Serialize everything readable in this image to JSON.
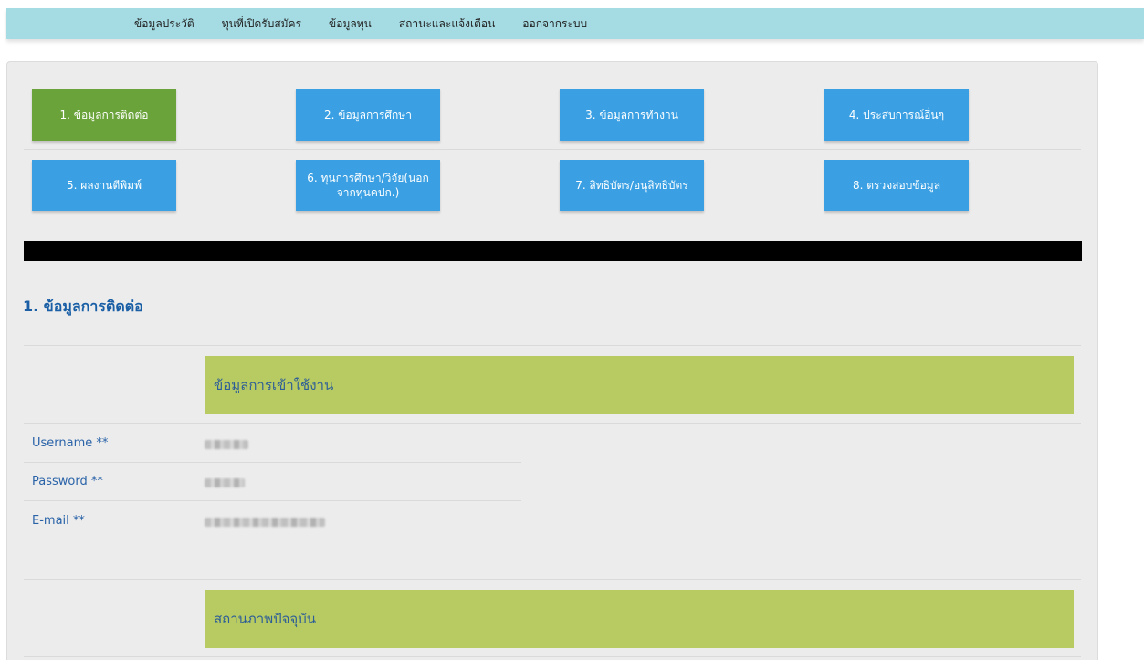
{
  "nav": {
    "items": [
      {
        "label": "ข้อมูลประวัติ"
      },
      {
        "label": "ทุนที่เปิดรับสมัคร"
      },
      {
        "label": "ข้อมูลทุน"
      },
      {
        "label": "สถานะและแจ้งเตือน"
      },
      {
        "label": "ออกจากระบบ"
      }
    ]
  },
  "steps": [
    {
      "label": "1. ข้อมูลการติดต่อ",
      "active": true
    },
    {
      "label": "2. ข้อมูลการศึกษา",
      "active": false
    },
    {
      "label": "3. ข้อมูลการทำงาน",
      "active": false
    },
    {
      "label": "4. ประสบการณ์อื่นๆ",
      "active": false
    },
    {
      "label": "5. ผลงานตีพิมพ์",
      "active": false
    },
    {
      "label": "6. ทุนการศึกษา/วิจัย(นอกจากทุนคปก.)",
      "active": false
    },
    {
      "label": "7. สิทธิบัตร/อนุสิทธิบัตร",
      "active": false
    },
    {
      "label": "8. ตรวจสอบข้อมูล",
      "active": false
    }
  ],
  "section": {
    "title": "1. ข้อมูลการติดต่อ"
  },
  "groups": {
    "login_header": "ข้อมูลการเข้าใช้งาน",
    "status_header": "สถานภาพปัจจุบัน"
  },
  "fields": [
    {
      "label": "Username **",
      "value": ""
    },
    {
      "label": "Password **",
      "value": ""
    },
    {
      "label": "E-mail **",
      "value": ""
    }
  ],
  "colors": {
    "topbar": "#a5dce4",
    "step_active": "#6aa33a",
    "step_default": "#3aa0e3",
    "group_header": "#b8cb63",
    "label_blue": "#2a63a8"
  }
}
